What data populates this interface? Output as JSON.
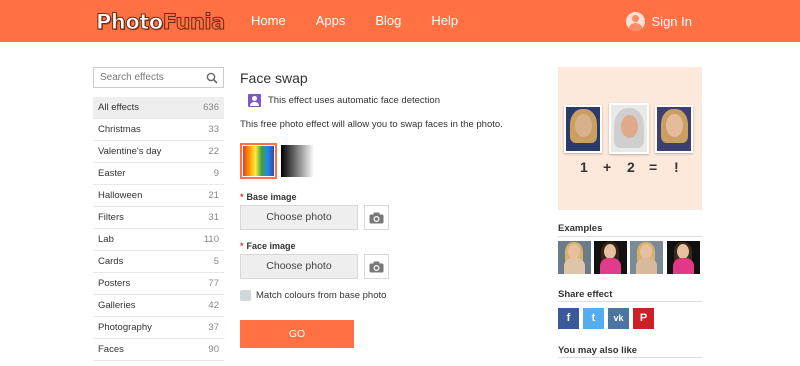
{
  "header": {
    "logo_part1": "Photo",
    "logo_part2": "Funia",
    "nav": [
      "Home",
      "Apps",
      "Blog",
      "Help"
    ],
    "signin": "Sign In"
  },
  "sidebar": {
    "search_placeholder": "Search effects",
    "categories": [
      {
        "label": "All effects",
        "count": "636"
      },
      {
        "label": "Christmas",
        "count": "33"
      },
      {
        "label": "Valentine's day",
        "count": "22"
      },
      {
        "label": "Easter",
        "count": "9"
      },
      {
        "label": "Halloween",
        "count": "21"
      },
      {
        "label": "Filters",
        "count": "31"
      },
      {
        "label": "Lab",
        "count": "110"
      },
      {
        "label": "Cards",
        "count": "5"
      },
      {
        "label": "Posters",
        "count": "77"
      },
      {
        "label": "Galleries",
        "count": "42"
      },
      {
        "label": "Photography",
        "count": "37"
      },
      {
        "label": "Faces",
        "count": "90"
      }
    ]
  },
  "main": {
    "title": "Face swap",
    "face_detection": "This effect uses automatic face detection",
    "description": "This free photo effect will allow you to swap faces in the photo.",
    "base_label": "Base image",
    "face_label": "Face image",
    "required_mark": "*",
    "choose_photo": "Choose photo",
    "match_colours": "Match colours from base photo",
    "go": "GO"
  },
  "right": {
    "equation": [
      "1",
      "+",
      "2",
      "=",
      "!"
    ],
    "examples_heading": "Examples",
    "share_heading": "Share effect",
    "share_buttons": [
      "f",
      "t",
      "vk",
      "P"
    ],
    "also_like_heading": "You may also like"
  },
  "colors": {
    "brand": "#ff7043",
    "facebook": "#3b5998",
    "twitter": "#55acee",
    "vk": "#4c75a3",
    "pinterest": "#cb2027"
  }
}
